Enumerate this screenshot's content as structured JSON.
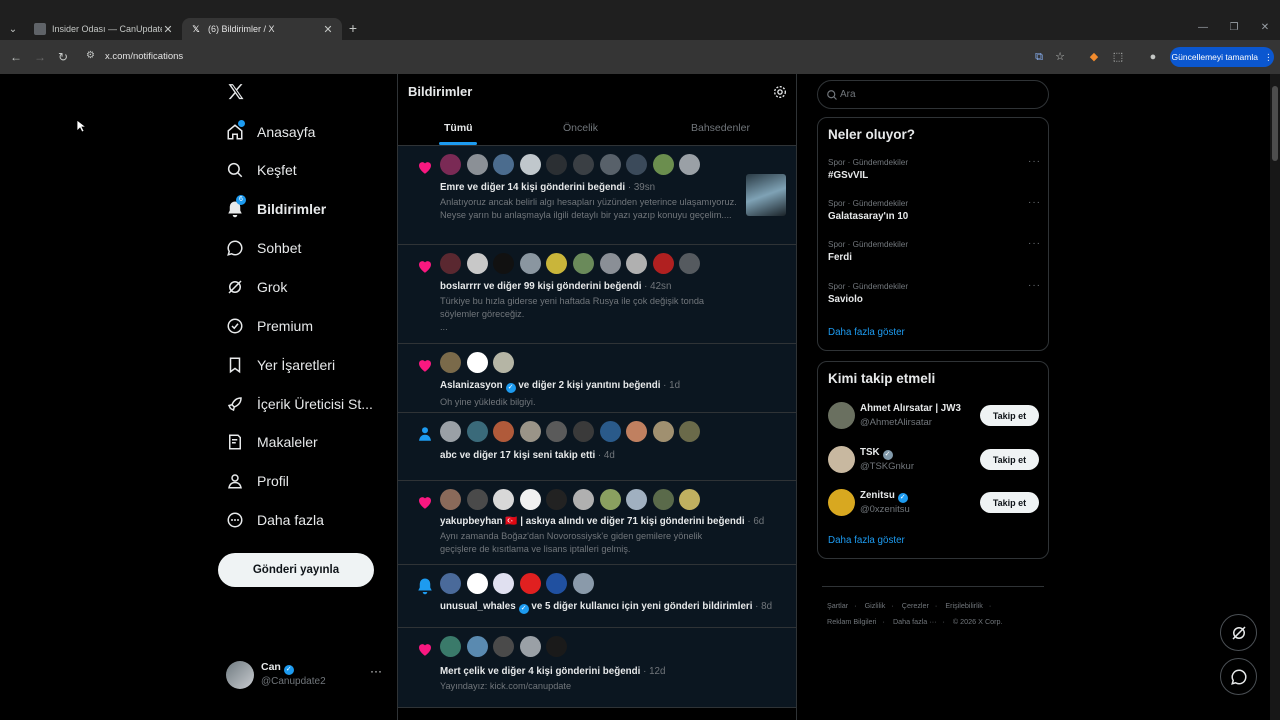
{
  "browser": {
    "tabs": [
      {
        "title": "Insider Odası — CanUpdate"
      },
      {
        "title": "(6) Bildirimler / X"
      }
    ],
    "new_tab": "+",
    "url": "x.com/notifications",
    "update_button": "Güncellemeyi tamamla"
  },
  "nav": {
    "items": [
      {
        "label": "Anasayfa"
      },
      {
        "label": "Keşfet"
      },
      {
        "label": "Bildirimler",
        "badge": "6"
      },
      {
        "label": "Sohbet"
      },
      {
        "label": "Grok"
      },
      {
        "label": "Premium"
      },
      {
        "label": "Yer İşaretleri"
      },
      {
        "label": "İçerik Üreticisi St..."
      },
      {
        "label": "Makaleler"
      },
      {
        "label": "Profil"
      },
      {
        "label": "Daha fazla"
      }
    ],
    "post_button": "Gönderi yayınla",
    "profile": {
      "name": "Can",
      "handle": "@Canupdate2"
    }
  },
  "center": {
    "title": "Bildirimler",
    "tabs": [
      "Tümü",
      "Öncelik",
      "Bahsedenler"
    ],
    "notifications": [
      {
        "kind": "like",
        "actor": "Emre",
        "action": " ve diğer 14 kişi gönderini beğendi",
        "time": " · 39sn",
        "body": "Anlatıyoruz ancak belirli algı hesapları yüzünden yeterince ulaşamıyoruz. Neyse yarın bu anlaşmayla ilgili detaylı bir yazı yazıp konuyu geçelim....",
        "avatar_colors": [
          "#7a2a55",
          "#8b9096",
          "#4b6c8e",
          "#c0c7cc",
          "#2b2f33",
          "#3a3f44",
          "#58616a",
          "#3b4a5a",
          "#6b8e4e",
          "#9aa0a6"
        ]
      },
      {
        "kind": "like",
        "actor": "boslarrrr",
        "action": " ve diğer 99 kişi gönderini beğendi",
        "time": " · 42sn",
        "body": "Türkiye bu hızla giderse yeni haftada Rusya ile çok değişik tonda söylemler göreceğiz.\n...",
        "avatar_colors": [
          "#5a2830",
          "#c8c8c8",
          "#111111",
          "#8a96a0",
          "#c9b53a",
          "#6a8a5a",
          "#8a8f96",
          "#b0b0b0",
          "#b02020",
          "#555a5f"
        ]
      },
      {
        "kind": "like",
        "actor": "Aslanizasyon",
        "action": " ve diğer 2 kişi yanıtını beğendi",
        "time": " · 1d",
        "body": "Oh yine yükledik bilgiyi.",
        "avatar_colors": [
          "#7a6a4a",
          "#ffffff",
          "#b5b5a5"
        ]
      },
      {
        "kind": "follow",
        "actor": "abc",
        "action": " ve diğer 17 kişi seni takip etti",
        "time": " · 4d",
        "body": "",
        "avatar_colors": [
          "#9aa0a6",
          "#3a6a7a",
          "#b05a3a",
          "#9a9488",
          "#5a5a5a",
          "#3a3a3a",
          "#2a5a8a",
          "#c08060",
          "#a09070",
          "#6a6a4a"
        ]
      },
      {
        "kind": "like",
        "actor": "yakupbeyhan",
        "action": " ve diğer 71 kişi gönderini beğendi",
        "extra": " 🇹🇷 | askıya alındı",
        "time": " · 6d",
        "body": "Aynı zamanda Boğaz'dan Novorossiysk'e giden gemilere yönelik geçişlere de kısıtlama ve lisans iptalleri gelmiş.",
        "avatar_colors": [
          "#8a6a5a",
          "#4a4a4a",
          "#d8d8d8",
          "#f0f0f0",
          "#222222",
          "#b0b0b0",
          "#8aa060",
          "#a0b0c0",
          "#5a6a4a",
          "#c0b060"
        ]
      },
      {
        "kind": "bell",
        "actor": "unusual_whales",
        "action": " ve 5 diğer kullanıcı için yeni gönderi bildirimleri",
        "time": " · 8d",
        "body": "",
        "avatar_colors": [
          "#4a6a9a",
          "#ffffff",
          "#e0e0f0",
          "#e02020",
          "#2050a0",
          "#8a9aaa"
        ]
      },
      {
        "kind": "like",
        "actor": "Mert çelik",
        "action": " ve diğer 4 kişi gönderini beğendi",
        "time": " · 12d",
        "body": "Yayındayız: kick.com/canupdate",
        "avatar_colors": [
          "#3a7a6a",
          "#5a8ab0",
          "#4a4a4a",
          "#9aa0a6",
          "#1a1a1a"
        ]
      }
    ]
  },
  "right": {
    "search_placeholder": "Ara",
    "trends_title": "Neler oluyor?",
    "trends": [
      {
        "category": "Spor · Gündemdekiler",
        "name": "#GSvVIL"
      },
      {
        "category": "Spor · Gündemdekiler",
        "name": "Galatasaray'ın 10"
      },
      {
        "category": "Spor · Gündemdekiler",
        "name": "Ferdi"
      },
      {
        "category": "Spor · Gündemdekiler",
        "name": "Saviolo"
      }
    ],
    "show_more": "Daha fazla göster",
    "who_to_follow_title": "Kimi takip etmeli",
    "follow": [
      {
        "name": "Ahmet Alırsatar | JW3",
        "handle": "@AhmetAlirsatar",
        "button": "Takip et",
        "color": "#6a7060"
      },
      {
        "name": "TSK",
        "handle": "@TSKGnkur",
        "button": "Takip et",
        "color": "#c8b8a0"
      },
      {
        "name": "Zenitsu",
        "handle": "@0xzenitsu",
        "button": "Takip et",
        "color": "#d8a820"
      }
    ],
    "footer_row1": [
      "Şartlar",
      "Gizlilik",
      "Çerezler",
      "Erişilebilirlik"
    ],
    "footer_row2": [
      "Reklam Bilgileri",
      "Daha fazla ···",
      "© 2026 X Corp."
    ]
  },
  "colors": {
    "accent": "#1d9bf0",
    "like": "#f91880",
    "background": "#000000",
    "unread_row": "#0b1620"
  }
}
